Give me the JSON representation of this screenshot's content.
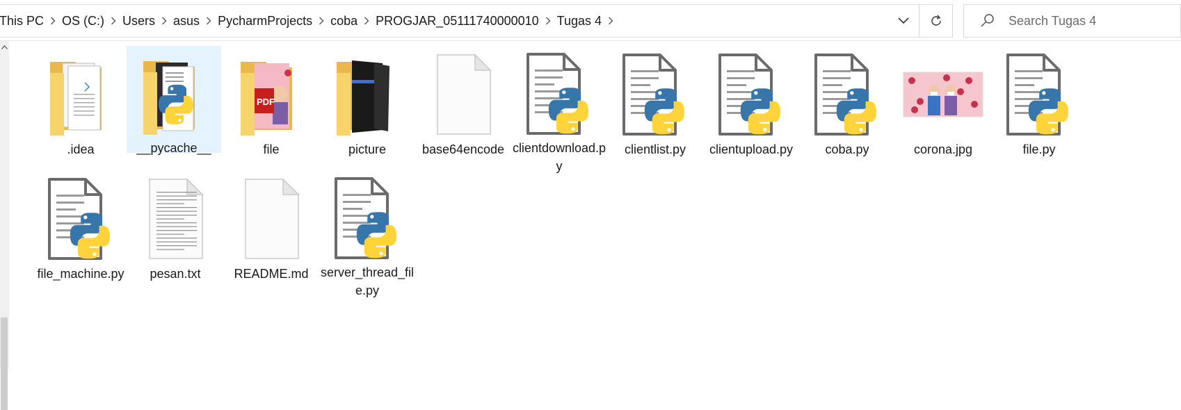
{
  "breadcrumb": [
    "This PC",
    "OS (C:)",
    "Users",
    "asus",
    "PycharmProjects",
    "coba",
    "PROGJAR_05111740000010",
    "Tugas 4"
  ],
  "search": {
    "placeholder": "Search Tugas 4"
  },
  "items": [
    {
      "name": ".idea",
      "type": "folder-docs",
      "selected": false
    },
    {
      "name": "__pycache__",
      "type": "folder-python",
      "selected": true
    },
    {
      "name": "file",
      "type": "folder-pdf",
      "selected": false
    },
    {
      "name": "picture",
      "type": "folder-dark",
      "selected": false
    },
    {
      "name": "base64encode",
      "type": "blank-file",
      "selected": false
    },
    {
      "name": "clientdownload.py",
      "type": "python-file",
      "selected": false
    },
    {
      "name": "clientlist.py",
      "type": "python-file",
      "selected": false
    },
    {
      "name": "clientupload.py",
      "type": "python-file",
      "selected": false
    },
    {
      "name": "coba.py",
      "type": "python-file",
      "selected": false
    },
    {
      "name": "corona.jpg",
      "type": "image-file",
      "selected": false
    },
    {
      "name": "file.py",
      "type": "python-file",
      "selected": false
    },
    {
      "name": "file_machine.py",
      "type": "python-file",
      "selected": false
    },
    {
      "name": "pesan.txt",
      "type": "text-file",
      "selected": false
    },
    {
      "name": "README.md",
      "type": "blank-file",
      "selected": false
    },
    {
      "name": "server_thread_file.py",
      "type": "python-file",
      "selected": false
    }
  ],
  "colors": {
    "selection": "#e5f3ff",
    "folder": "#f8d775",
    "python_blue": "#3776ab",
    "python_yellow": "#ffd43b"
  }
}
